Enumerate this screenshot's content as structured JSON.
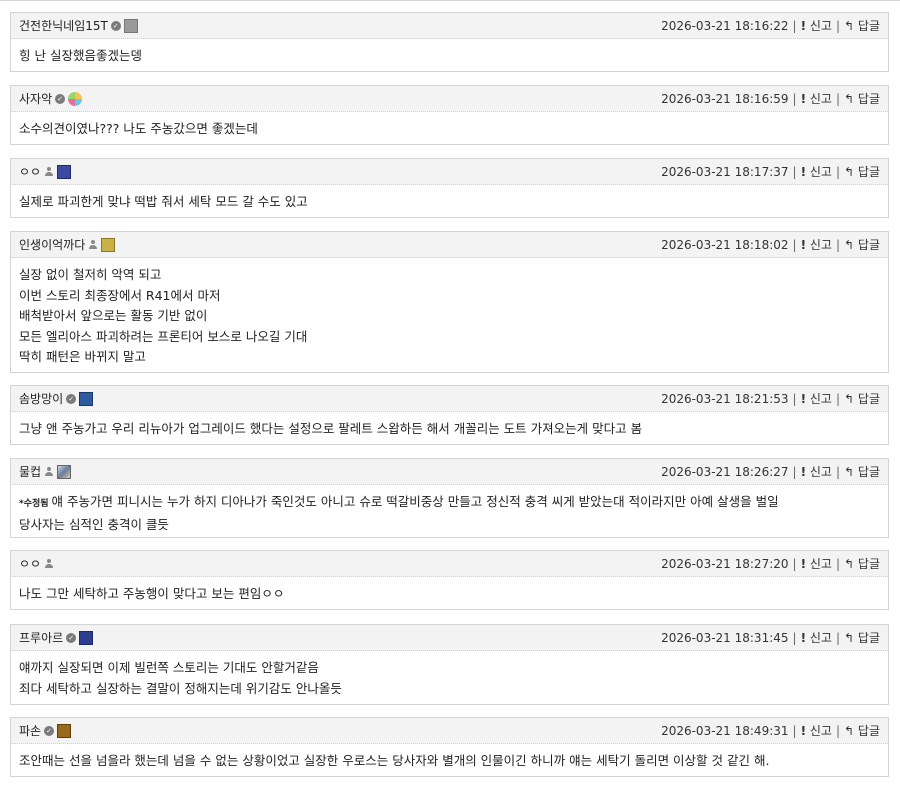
{
  "actions": {
    "report_label": "신고",
    "reply_label": "답글",
    "separator": "|"
  },
  "edited_tag": "*수정됨",
  "icons": {
    "verified": "check-circle-icon",
    "member": "person-icon",
    "report": "exclamation-icon",
    "reply": "reply-arrow-icon"
  },
  "comments": [
    {
      "nick": "건전한닉네임15T",
      "verified": true,
      "member": false,
      "badge": "gray",
      "timestamp": "2026-03-21 18:16:22",
      "edited": false,
      "lines": [
        "힝 난 실장했음좋겠는뎅"
      ]
    },
    {
      "nick": "사자악",
      "verified": true,
      "member": false,
      "badge": "color",
      "timestamp": "2026-03-21 18:16:59",
      "edited": false,
      "lines": [
        "소수의견이였나??? 나도 주농갔으면 좋겠는데"
      ]
    },
    {
      "nick": "ㅇㅇ",
      "verified": false,
      "member": true,
      "badge": "navy",
      "timestamp": "2026-03-21 18:17:37",
      "edited": false,
      "lines": [
        "실제로 파괴한게 맞냐 떡밥 줘서 세탁 모드 갈 수도 있고"
      ]
    },
    {
      "nick": "인생이억까다",
      "verified": false,
      "member": true,
      "badge": "gold",
      "timestamp": "2026-03-21 18:18:02",
      "edited": false,
      "lines": [
        "실장 없이 철저히 악역 되고",
        "이번 스토리 최종장에서 R41에서 마저",
        "배척받아서 앞으로는 활동 기반 없이",
        "모든 엘리아스 파괴하려는 프론티어 보스로 나오길 기대",
        "딱히 패턴은 바뀌지 말고"
      ]
    },
    {
      "nick": "솜방망이",
      "verified": true,
      "member": false,
      "badge": "blue",
      "timestamp": "2026-03-21 18:21:53",
      "edited": false,
      "lines": [
        "그냥 앤 주농가고 우리 리뉴아가 업그레이드 했다는 설정으로 팔레트 스왑하든 해서 개꼴리는 도트 가져오는게 맞다고 봄"
      ]
    },
    {
      "nick": "물컵",
      "verified": false,
      "member": true,
      "badge": "multi",
      "timestamp": "2026-03-21 18:26:27",
      "edited": true,
      "lines": [
        "얘 주농가면 피니시는 누가 하지 디아나가 죽인것도 아니고 슈로 떡갈비중상 만들고 정신적 충격 씨게 받았는대 적이라지만 아예 살생을 벌일",
        "당사자는 심적인 충격이 클듯"
      ]
    },
    {
      "nick": "ㅇㅇ",
      "verified": false,
      "member": true,
      "badge": "",
      "timestamp": "2026-03-21 18:27:20",
      "edited": false,
      "lines": [
        "나도 그만 세탁하고 주농행이 맞다고 보는 편임ㅇㅇ"
      ]
    },
    {
      "nick": "프루아르",
      "verified": true,
      "member": false,
      "badge": "yellow",
      "timestamp": "2026-03-21 18:31:45",
      "edited": false,
      "lines": [
        "얘까지 실장되면 이제 빌런쪽 스토리는 기대도 안할거같음",
        "죄다 세탁하고 실장하는 결말이 정해지는데 위기감도 안나올듯"
      ]
    },
    {
      "nick": "파손",
      "verified": true,
      "member": false,
      "badge": "brown",
      "timestamp": "2026-03-21 18:49:31",
      "edited": false,
      "lines": [
        "조안때는 선을 넘을라 했는데 넘을 수 없는 상황이었고 실장한 우로스는 당사자와 별개의 인물이긴 하니까 얘는 세탁기 돌리면 이상할 것 같긴 해."
      ]
    }
  ]
}
